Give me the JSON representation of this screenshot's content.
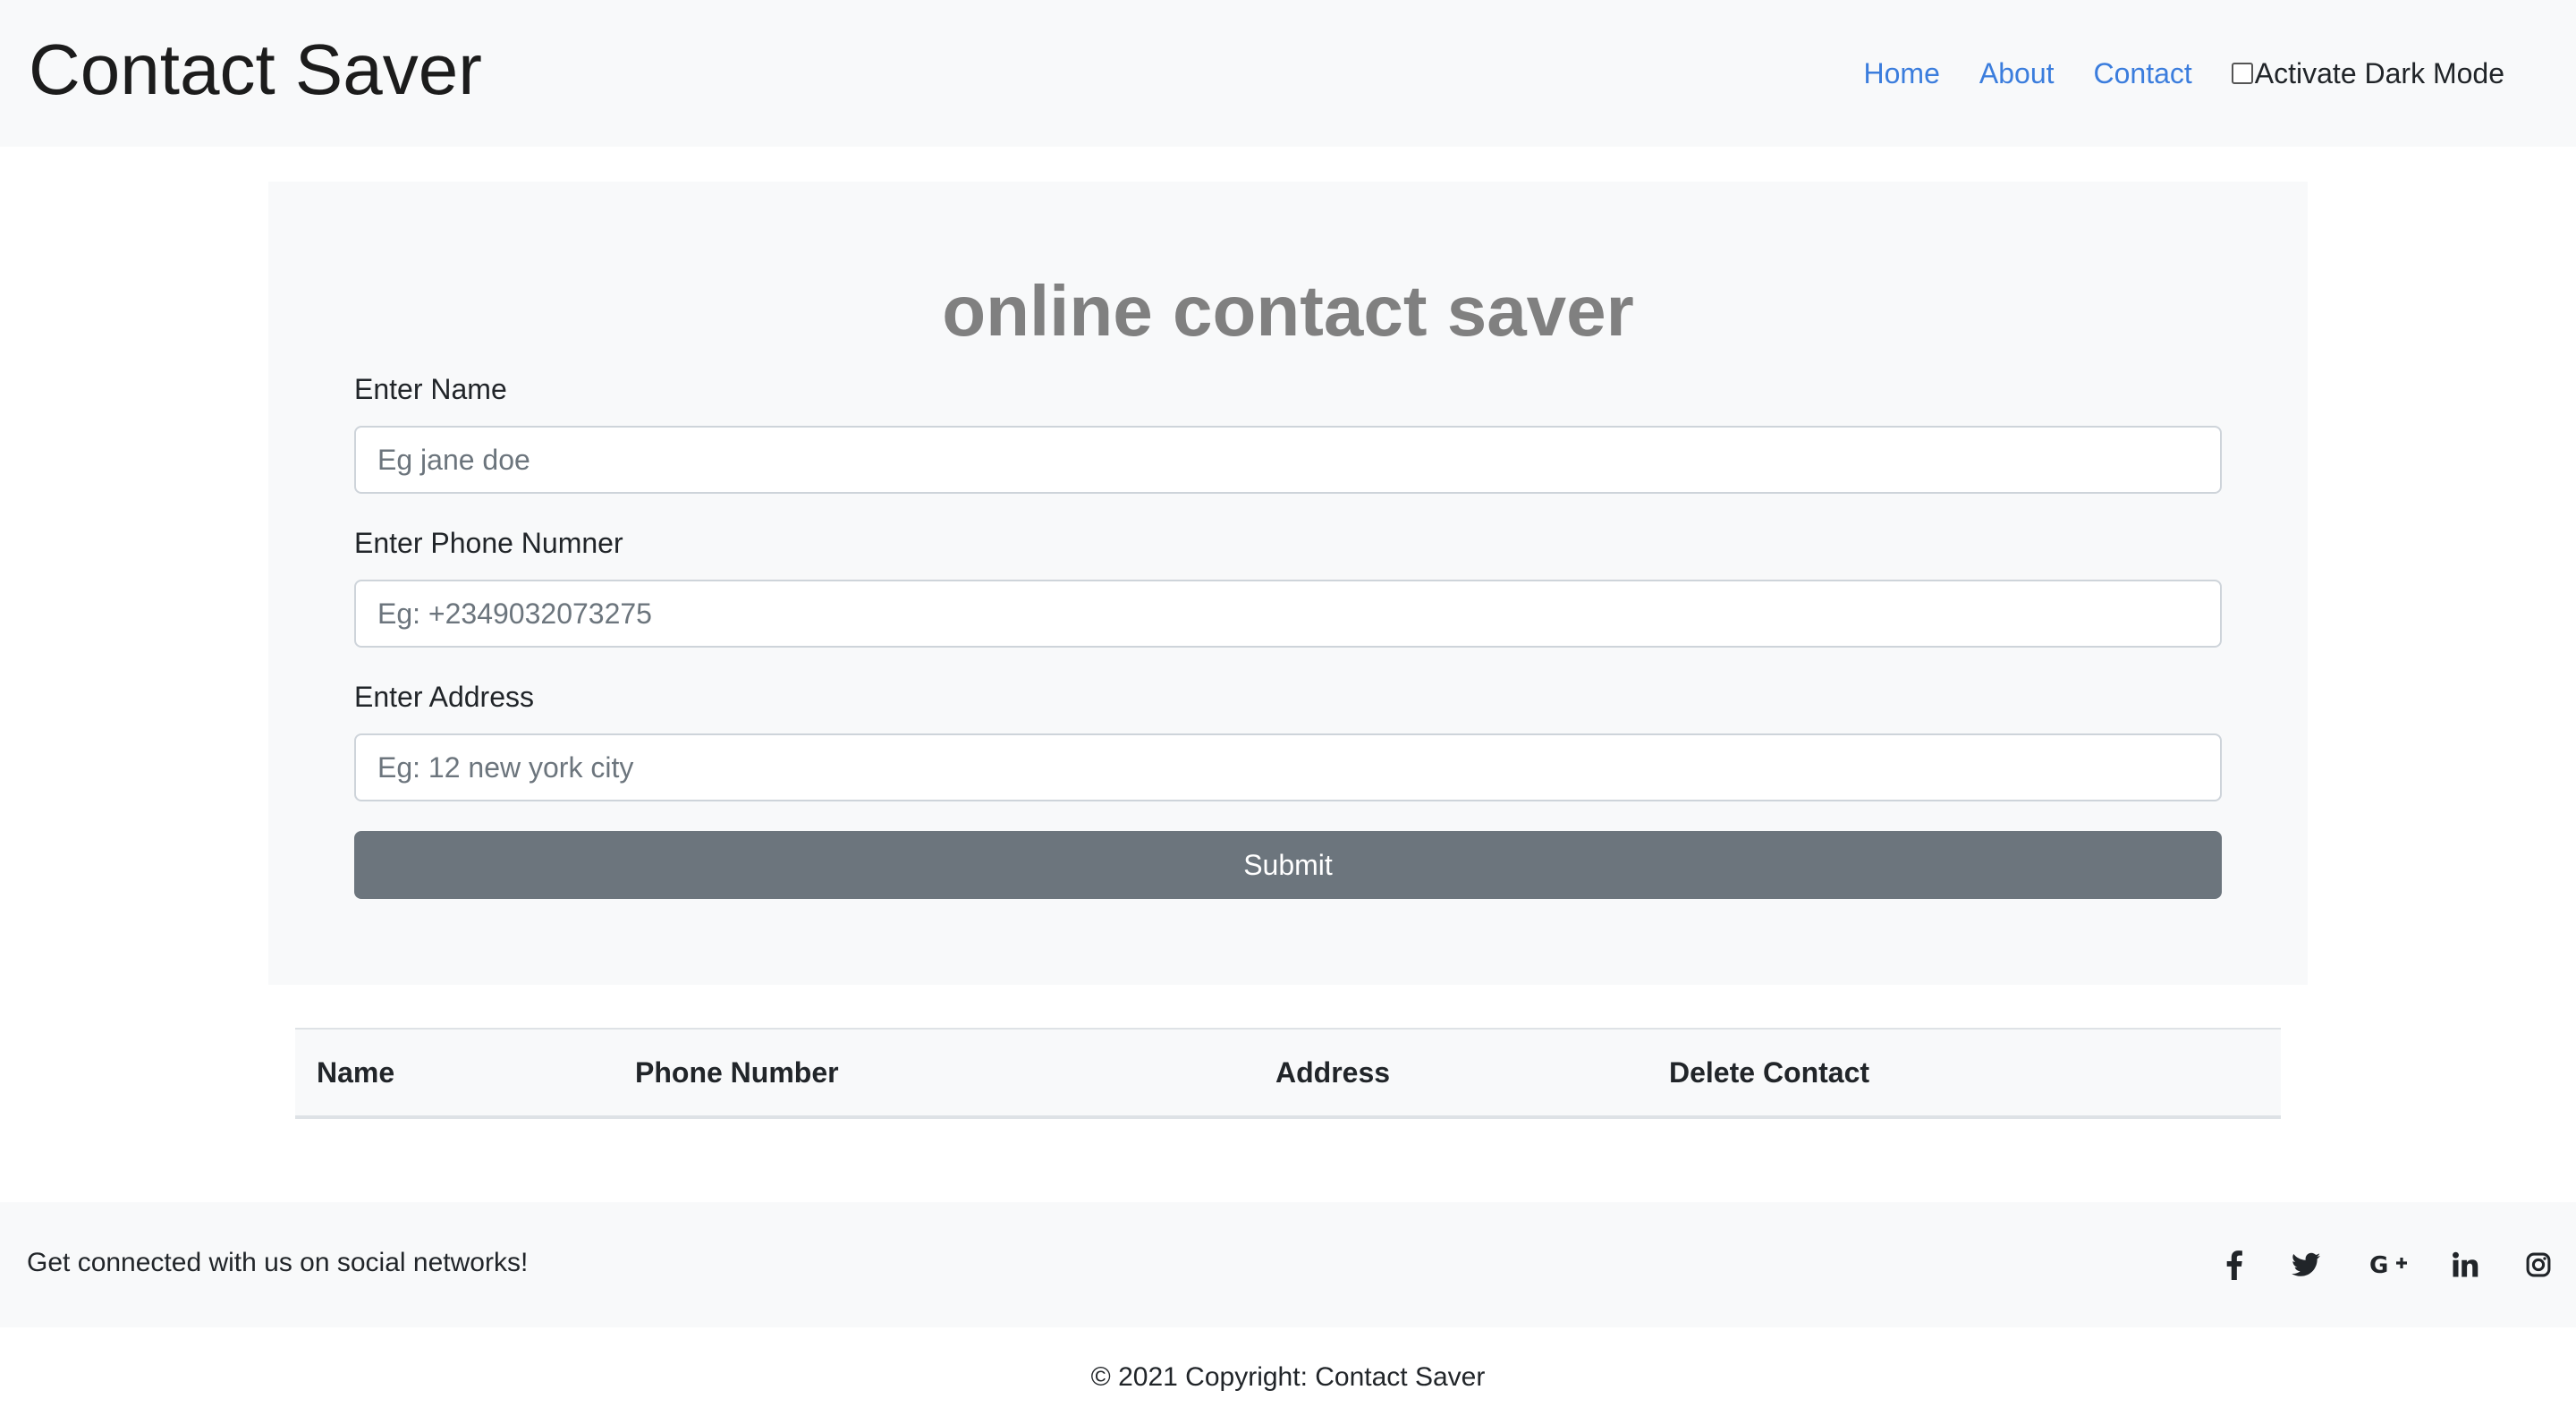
{
  "navbar": {
    "brand": "Contact Saver",
    "links": [
      "Home",
      "About",
      "Contact"
    ],
    "dark_mode_label": "Activate Dark Mode",
    "dark_mode_checked": false
  },
  "form": {
    "title": "online contact saver",
    "name_label": "Enter Name",
    "name_placeholder": "Eg  jane doe",
    "phone_label": "Enter Phone Numner",
    "phone_placeholder": "Eg: +2349032073275",
    "address_label": "Enter Address",
    "address_placeholder": "Eg: 12 new york city",
    "submit_label": "Submit"
  },
  "table": {
    "headers": [
      "Name",
      "Phone Number",
      "Address",
      "Delete Contact"
    ],
    "rows": []
  },
  "footer": {
    "connect_text": "Get connected with us on social networks!",
    "social_icons": [
      "facebook-icon",
      "twitter-icon",
      "google-plus-icon",
      "linkedin-icon",
      "instagram-icon"
    ],
    "copyright": "© 2021 Copyright: Contact Saver"
  },
  "colors": {
    "link": "#3b7ddd",
    "light_bg": "#f8f9fa",
    "button": "#6c757d",
    "title": "#808080"
  }
}
